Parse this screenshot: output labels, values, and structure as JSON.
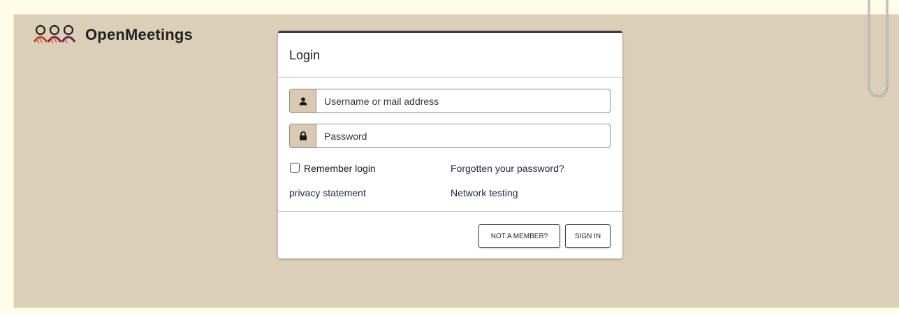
{
  "app": {
    "logo_text": "OpenMeetings"
  },
  "login": {
    "title": "Login",
    "username_placeholder": "Username or mail address",
    "password_placeholder": "Password",
    "remember_label": "Remember login",
    "forgot_password_link": "Forgotten your password?",
    "privacy_link": "privacy statement",
    "network_link": "Network testing",
    "not_member_button": "NOT A MEMBER?",
    "sign_in_button": "SIGN IN",
    "remember_checked": false
  },
  "icons": {
    "username": "user-icon",
    "password": "lock-icon",
    "logo": "people-icon",
    "paperclip": "paperclip-icon"
  },
  "colors": {
    "background": "#dccfb8",
    "addon": "#d9c9b0",
    "outer": "#fffde8"
  }
}
